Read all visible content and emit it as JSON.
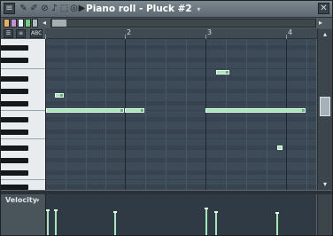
{
  "window": {
    "title": "Piano roll - Pluck #2",
    "title_caret": "▾",
    "menu_glyph": "≡",
    "close_glyph": "✕"
  },
  "toolbar": {
    "tools": [
      "pencil-icon",
      "paint-icon",
      "delete-icon",
      "mute-icon",
      "slice-icon",
      "select-icon",
      "zoom-icon",
      "playback-icon"
    ],
    "swatch_colors": [
      "#e6b25c",
      "#c58fd8",
      "#e6ecf0",
      "#6fcf7e",
      "#b0bac0"
    ]
  },
  "tools_row": {
    "btn1": "☰",
    "btn2": "≡",
    "btn3": "ABC"
  },
  "ruler": {
    "bars": [
      "2",
      "3",
      "4"
    ]
  },
  "velocity": {
    "label": "Velocity",
    "caret": "▾"
  },
  "scroll": {
    "left": "◂",
    "right": "▸",
    "up": "▴",
    "down": "▾"
  },
  "notes_count_visible": 6
}
